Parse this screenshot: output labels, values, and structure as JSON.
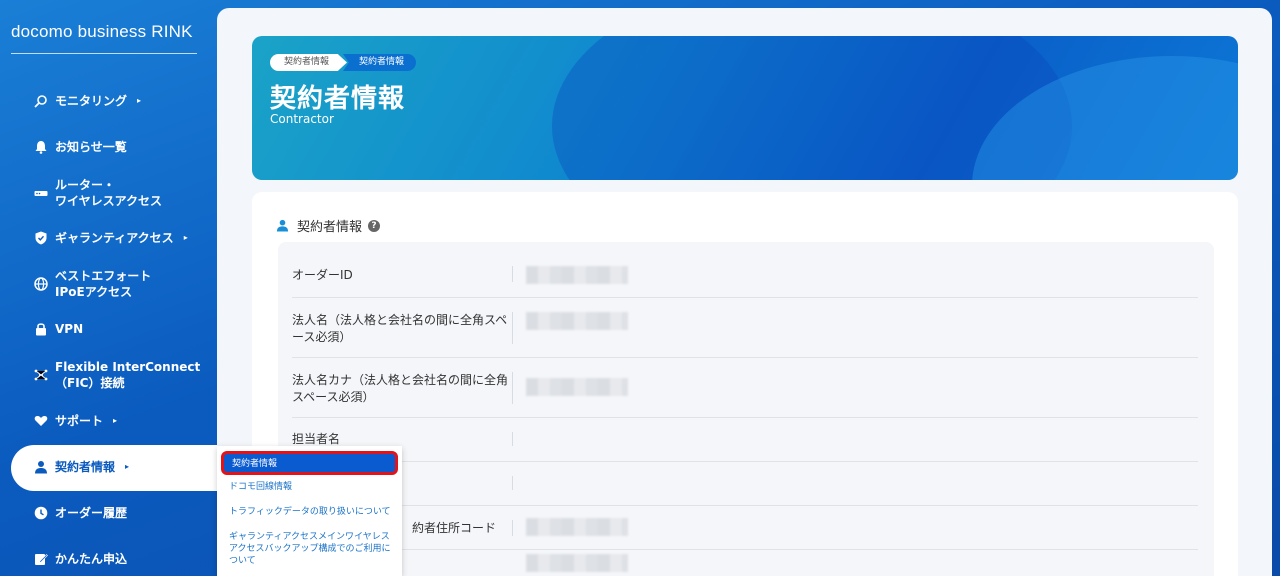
{
  "brand": "docomo business RINK",
  "sidebar": {
    "items": [
      {
        "icon": "monitoring-icon",
        "label": "モニタリング",
        "caret": "▸"
      },
      {
        "icon": "bell-icon",
        "label": "お知らせ一覧"
      },
      {
        "icon": "router-icon",
        "label_line1": "ルーター・",
        "label_line2": "ワイヤレスアクセス"
      },
      {
        "icon": "shield-icon",
        "label": "ギャランティアクセス",
        "caret": "▸"
      },
      {
        "icon": "globe-icon",
        "label_line1": "ベストエフォート",
        "label_line2": "IPoEアクセス"
      },
      {
        "icon": "lock-icon",
        "label": "VPN"
      },
      {
        "icon": "network-icon",
        "label_line1": "Flexible InterConnect",
        "label_line2": "（FIC）接続"
      },
      {
        "icon": "heart-hand-icon",
        "label": "サポート",
        "caret": "▸"
      },
      {
        "icon": "person-icon",
        "label": "契約者情報",
        "caret": "▸"
      },
      {
        "icon": "clock-icon",
        "label": "オーダー履歴"
      },
      {
        "icon": "edit-icon",
        "label": "かんたん申込"
      }
    ]
  },
  "hero": {
    "breadcrumb": [
      "契約者情報",
      "契約者情報"
    ],
    "title": "契約者情報",
    "subtitle": "Contractor"
  },
  "card": {
    "heading": "契約者情報",
    "help": "?",
    "rows": [
      {
        "label": "オーダーID"
      },
      {
        "label": "法人名（法人格と会社名の間に全角スペース必須）"
      },
      {
        "label": "法人名カナ（法人格と会社名の間に全角スペース必須）"
      },
      {
        "label": "担当者名"
      },
      {
        "label": ""
      },
      {
        "label": "約者住所コード"
      },
      {
        "label": ""
      }
    ]
  },
  "submenu": {
    "selected": "契約者情報",
    "options": [
      "ドコモ回線情報",
      "トラフィックデータの取り扱いについて",
      "ギャランティアクセスメインワイヤレスアクセスバックアップ構成でのご利用について"
    ]
  },
  "colors": {
    "accent": "#0b5bbf",
    "highlight_border": "#e0141a"
  }
}
